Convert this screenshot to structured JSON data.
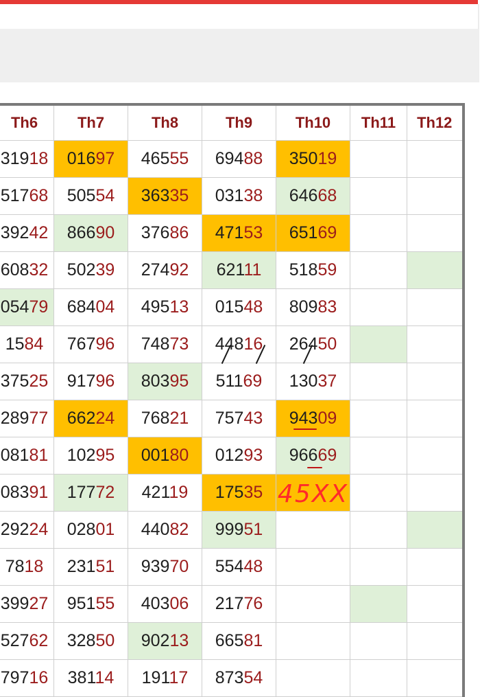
{
  "headers": [
    "Th6",
    "Th7",
    "Th8",
    "Th9",
    "Th10",
    "Th11",
    "Th12"
  ],
  "rows": [
    [
      {
        "a": "319",
        "b": "18"
      },
      {
        "a": "016",
        "b": "97",
        "bg": "orange"
      },
      {
        "a": "465",
        "b": "55"
      },
      {
        "a": "694",
        "b": "88"
      },
      {
        "a": "350",
        "b": "19",
        "bg": "orange"
      },
      {},
      {}
    ],
    [
      {
        "a": "517",
        "b": "68"
      },
      {
        "a": "505",
        "b": "54"
      },
      {
        "a": "363",
        "b": "35",
        "bg": "orange"
      },
      {
        "a": "031",
        "b": "38"
      },
      {
        "a": "646",
        "b": "68",
        "bg": "green"
      },
      {},
      {}
    ],
    [
      {
        "a": "392",
        "b": "42"
      },
      {
        "a": "866",
        "b": "90",
        "bg": "green"
      },
      {
        "a": "376",
        "b": "86"
      },
      {
        "a": "471",
        "b": "53",
        "bg": "orange"
      },
      {
        "a": "651",
        "b": "69",
        "bg": "orange"
      },
      {},
      {}
    ],
    [
      {
        "a": "608",
        "b": "32"
      },
      {
        "a": "502",
        "b": "39"
      },
      {
        "a": "274",
        "b": "92"
      },
      {
        "a": "621",
        "b": "11",
        "bg": "green"
      },
      {
        "a": "518",
        "b": "59"
      },
      {},
      {
        "bg": "green"
      }
    ],
    [
      {
        "a": "054",
        "b": "79",
        "bg": "green"
      },
      {
        "a": "684",
        "b": "04"
      },
      {
        "a": "495",
        "b": "13"
      },
      {
        "a": "015",
        "b": "48"
      },
      {
        "a": "809",
        "b": "83"
      },
      {},
      {}
    ],
    [
      {
        "a": "15",
        "b": "84"
      },
      {
        "a": "767",
        "b": "96"
      },
      {
        "a": "748",
        "b": "73"
      },
      {
        "a": "448",
        "b": "16"
      },
      {
        "a": "264",
        "b": "50"
      },
      {
        "bg": "green"
      },
      {}
    ],
    [
      {
        "a": "375",
        "b": "25"
      },
      {
        "a": "917",
        "b": "96"
      },
      {
        "a": "803",
        "b": "95",
        "bg": "green"
      },
      {
        "a": "511",
        "b": "69"
      },
      {
        "a": "130",
        "b": "37"
      },
      {},
      {}
    ],
    [
      {
        "a": "289",
        "b": "77"
      },
      {
        "a": "662",
        "b": "24",
        "bg": "orange"
      },
      {
        "a": "768",
        "b": "21"
      },
      {
        "a": "757",
        "b": "43"
      },
      {
        "a": "943",
        "b": "09",
        "bg": "orange"
      },
      {},
      {}
    ],
    [
      {
        "a": "081",
        "b": "81"
      },
      {
        "a": "102",
        "b": "95"
      },
      {
        "a": "001",
        "b": "80",
        "bg": "orange"
      },
      {
        "a": "012",
        "b": "93"
      },
      {
        "a": "966",
        "b": "69",
        "bg": "green"
      },
      {},
      {}
    ],
    [
      {
        "a": "083",
        "b": "91"
      },
      {
        "a": "177",
        "b": "72",
        "bg": "green"
      },
      {
        "a": "421",
        "b": "19"
      },
      {
        "a": "175",
        "b": "35",
        "bg": "orange"
      },
      {
        "hand": "45XX",
        "bg": "orange"
      },
      {},
      {}
    ],
    [
      {
        "a": "292",
        "b": "24"
      },
      {
        "a": "028",
        "b": "01"
      },
      {
        "a": "440",
        "b": "82"
      },
      {
        "a": "999",
        "b": "51",
        "bg": "green"
      },
      {},
      {},
      {
        "bg": "green"
      }
    ],
    [
      {
        "a": "78",
        "b": "18"
      },
      {
        "a": "231",
        "b": "51"
      },
      {
        "a": "939",
        "b": "70"
      },
      {
        "a": "554",
        "b": "48"
      },
      {},
      {},
      {}
    ],
    [
      {
        "a": "399",
        "b": "27"
      },
      {
        "a": "951",
        "b": "55"
      },
      {
        "a": "403",
        "b": "06"
      },
      {
        "a": "217",
        "b": "76"
      },
      {},
      {
        "bg": "green"
      },
      {}
    ],
    [
      {
        "a": "527",
        "b": "62"
      },
      {
        "a": "328",
        "b": "50"
      },
      {
        "a": "902",
        "b": "13",
        "bg": "green"
      },
      {
        "a": "665",
        "b": "81"
      },
      {},
      {},
      {}
    ],
    [
      {
        "a": "797",
        "b": "16"
      },
      {
        "a": "381",
        "b": "14"
      },
      {
        "a": "191",
        "b": "17"
      },
      {
        "a": "873",
        "b": "54"
      },
      {},
      {},
      {}
    ]
  ]
}
